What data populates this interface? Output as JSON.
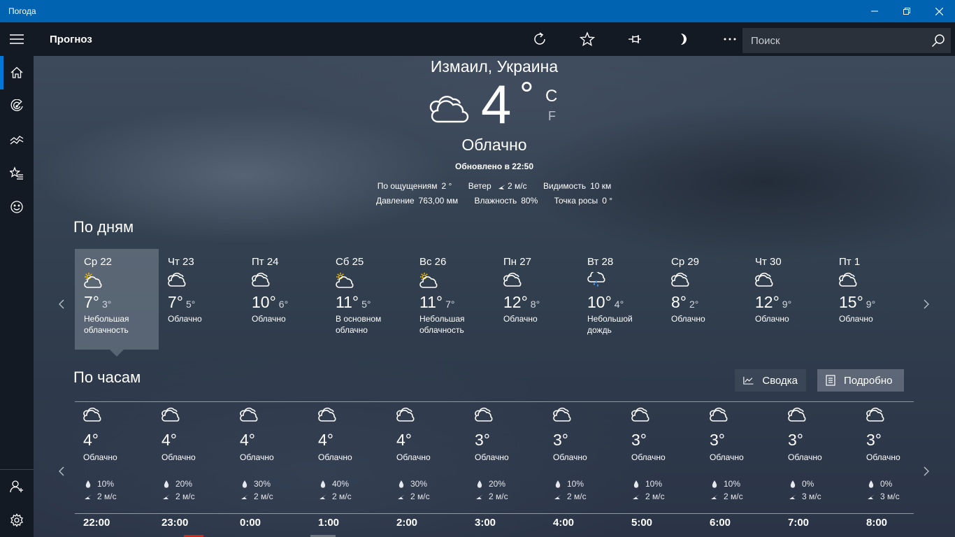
{
  "window": {
    "title": "Погода"
  },
  "toolbar": {
    "page_title": "Прогноз",
    "search_placeholder": "Поиск"
  },
  "current": {
    "city": "Измаил, Украина",
    "temperature": "4",
    "degree": "°",
    "unit_c": "C",
    "unit_f": "F",
    "condition": "Облачно",
    "updated": "Обновлено в 22:50",
    "feels_label": "По ощущениям",
    "feels_value": "2 °",
    "wind_label": "Ветер",
    "wind_value": "2 м/с",
    "visibility_label": "Видимость",
    "visibility_value": "10 км",
    "pressure_label": "Давление",
    "pressure_value": "763,00 мм",
    "humidity_label": "Влажность",
    "humidity_value": "80%",
    "dew_label": "Точка росы",
    "dew_value": "0 °"
  },
  "daily": {
    "title": "По дням",
    "days": [
      {
        "name": "Ср 22",
        "hi": "7°",
        "lo": "3°",
        "desc": "Небольшая облачность",
        "icon": "partly-sunny-icon"
      },
      {
        "name": "Чт 23",
        "hi": "7°",
        "lo": "5°",
        "desc": "Облачно",
        "icon": "cloud-icon"
      },
      {
        "name": "Пт 24",
        "hi": "10°",
        "lo": "6°",
        "desc": "Облачно",
        "icon": "cloud-icon"
      },
      {
        "name": "Сб 25",
        "hi": "11°",
        "lo": "5°",
        "desc": "В основном облачно",
        "icon": "partly-sunny-icon"
      },
      {
        "name": "Вс 26",
        "hi": "11°",
        "lo": "7°",
        "desc": "Небольшая облачность",
        "icon": "partly-sunny-icon"
      },
      {
        "name": "Пн 27",
        "hi": "12°",
        "lo": "8°",
        "desc": "Облачно",
        "icon": "cloud-icon"
      },
      {
        "name": "Вт 28",
        "hi": "10°",
        "lo": "4°",
        "desc": "Небольшой дождь",
        "icon": "rain-icon"
      },
      {
        "name": "Ср 29",
        "hi": "8°",
        "lo": "2°",
        "desc": "Облачно",
        "icon": "cloud-icon"
      },
      {
        "name": "Чт 30",
        "hi": "12°",
        "lo": "9°",
        "desc": "Облачно",
        "icon": "cloud-icon"
      },
      {
        "name": "Пт 1",
        "hi": "15°",
        "lo": "9°",
        "desc": "Облачно",
        "icon": "cloud-icon"
      }
    ]
  },
  "hourly": {
    "title": "По часам",
    "summary_label": "Сводка",
    "detailed_label": "Подробно",
    "hours": [
      {
        "time": "22:00",
        "temp": "4°",
        "desc": "Облачно",
        "precip": "10%",
        "wind": "2 м/с"
      },
      {
        "time": "23:00",
        "temp": "4°",
        "desc": "Облачно",
        "precip": "20%",
        "wind": "2 м/с"
      },
      {
        "time": "0:00",
        "temp": "4°",
        "desc": "Облачно",
        "precip": "30%",
        "wind": "2 м/с"
      },
      {
        "time": "1:00",
        "temp": "4°",
        "desc": "Облачно",
        "precip": "40%",
        "wind": "2 м/с"
      },
      {
        "time": "2:00",
        "temp": "4°",
        "desc": "Облачно",
        "precip": "30%",
        "wind": "2 м/с"
      },
      {
        "time": "3:00",
        "temp": "3°",
        "desc": "Облачно",
        "precip": "20%",
        "wind": "2 м/с"
      },
      {
        "time": "4:00",
        "temp": "3°",
        "desc": "Облачно",
        "precip": "10%",
        "wind": "2 м/с"
      },
      {
        "time": "5:00",
        "temp": "3°",
        "desc": "Облачно",
        "precip": "10%",
        "wind": "2 м/с"
      },
      {
        "time": "6:00",
        "temp": "3°",
        "desc": "Облачно",
        "precip": "10%",
        "wind": "2 м/с"
      },
      {
        "time": "7:00",
        "temp": "3°",
        "desc": "Облачно",
        "precip": "0%",
        "wind": "3 м/с"
      },
      {
        "time": "8:00",
        "temp": "3°",
        "desc": "Облачно",
        "precip": "0%",
        "wind": "3 м/с"
      }
    ]
  },
  "colors": {
    "titlebar": "#0063b1",
    "chrome": "#141a23",
    "accent": "#0078d7",
    "sun": "#f5c400",
    "rain": "#3fa0ff"
  }
}
